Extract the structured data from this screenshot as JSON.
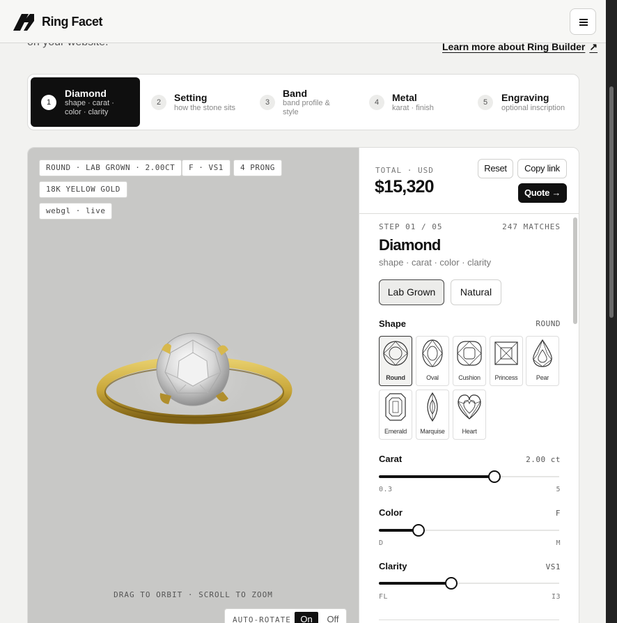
{
  "brand": {
    "name": "Ring Facet"
  },
  "intro": {
    "partial_text": "on your website.",
    "link_label": "Learn more about Ring Builder",
    "link_icon": "arrow-up-right-icon"
  },
  "steps": [
    {
      "num": "1",
      "title": "Diamond",
      "sub": "shape · carat · color · clarity",
      "active": true
    },
    {
      "num": "2",
      "title": "Setting",
      "sub": "how the stone sits",
      "active": false
    },
    {
      "num": "3",
      "title": "Band",
      "sub": "band profile & style",
      "active": false
    },
    {
      "num": "4",
      "title": "Metal",
      "sub": "karat · finish",
      "active": false
    },
    {
      "num": "5",
      "title": "Engraving",
      "sub": "optional inscription",
      "active": false
    }
  ],
  "viewer": {
    "tags": [
      "ROUND · LAB GROWN · 2.00CT",
      "F · VS1",
      "4 PRONG",
      "18K YELLOW GOLD",
      "webgl · live"
    ],
    "hint": "DRAG TO ORBIT · SCROLL TO ZOOM",
    "auto_rotate": {
      "label": "AUTO-ROTATE",
      "on": "On",
      "off": "Off",
      "selected": "On"
    },
    "colors": {
      "stage": "#c8c8c6",
      "gold": "#c9a73a",
      "gold_dark": "#8a6c17"
    }
  },
  "summary": {
    "total_label": "TOTAL · USD",
    "total": "$15,320",
    "reset": "Reset",
    "copy_link": "Copy link",
    "quote": "Quote →"
  },
  "diamond_step": {
    "step_label": "STEP 01 / 05",
    "matches": "247 MATCHES",
    "title": "Diamond",
    "subtitle": "shape · carat · color · clarity",
    "origin_options": [
      "Lab Grown",
      "Natural"
    ],
    "origin_selected": "Lab Grown",
    "shape_label": "Shape",
    "shape_value": "ROUND",
    "shapes": [
      "Round",
      "Oval",
      "Cushion",
      "Princess",
      "Pear",
      "Emerald",
      "Marquise",
      "Heart"
    ],
    "shape_selected": "Round",
    "carat": {
      "label": "Carat",
      "value": "2.00 ct",
      "min": "0.3",
      "max": "5",
      "fraction": 0.64
    },
    "color": {
      "label": "Color",
      "value": "F",
      "min": "D",
      "max": "M",
      "fraction": 0.22
    },
    "clarity": {
      "label": "Clarity",
      "value": "VS1",
      "min": "FL",
      "max": "I3",
      "fraction": 0.4
    }
  }
}
